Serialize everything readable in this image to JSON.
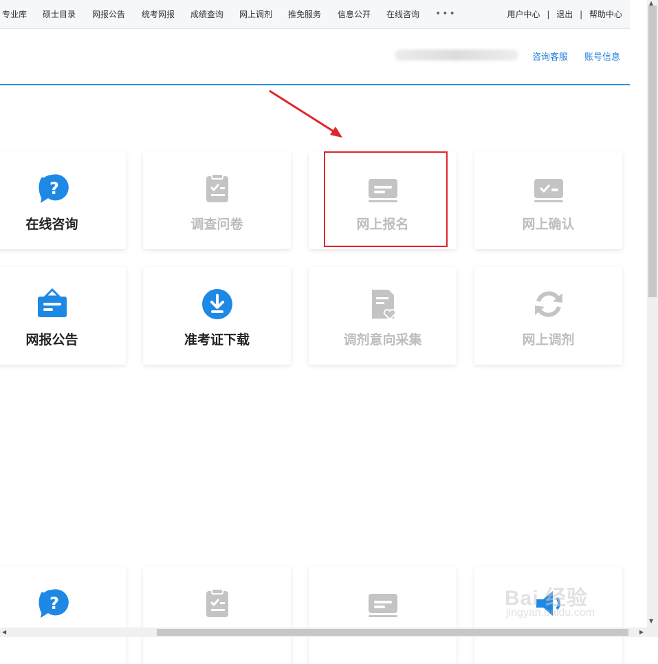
{
  "topnav": {
    "items": [
      "专业库",
      "硕士目录",
      "网报公告",
      "统考网报",
      "成绩查询",
      "网上调剂",
      "推免服务",
      "信息公开",
      "在线咨询"
    ],
    "more": "•••",
    "right": [
      "用户中心",
      "退出",
      "帮助中心"
    ],
    "separator": "|"
  },
  "header": {
    "user_name": "chsi_xxxxxxxxxxxxxx",
    "links": [
      "咨询客服",
      "账号信息"
    ]
  },
  "cards_row1": [
    {
      "label": "在线咨询",
      "icon": "question-bubble-icon",
      "state": "active"
    },
    {
      "label": "调查问卷",
      "icon": "clipboard-check-icon",
      "state": "disabled"
    },
    {
      "label": "网上报名",
      "icon": "card-form-icon",
      "state": "disabled"
    },
    {
      "label": "网上确认",
      "icon": "check-card-icon",
      "state": "disabled"
    }
  ],
  "cards_row2": [
    {
      "label": "网报公告",
      "icon": "notice-board-icon",
      "state": "active"
    },
    {
      "label": "准考证下载",
      "icon": "download-circle-icon",
      "state": "active"
    },
    {
      "label": "调剂意向采集",
      "icon": "doc-heart-icon",
      "state": "disabled"
    },
    {
      "label": "网上调剂",
      "icon": "refresh-icon",
      "state": "disabled"
    }
  ],
  "cards_row3_icons": [
    "question-bubble-icon",
    "clipboard-check-icon",
    "card-form-icon",
    "speaker-icon"
  ],
  "watermark": {
    "main": "Bai 经验",
    "sub": "jingyan.baidu.com"
  },
  "colors": {
    "accent": "#1e7fd9",
    "icon_active": "#1e88e5",
    "icon_disabled": "#c4c4c4",
    "highlight": "#e0262b"
  }
}
